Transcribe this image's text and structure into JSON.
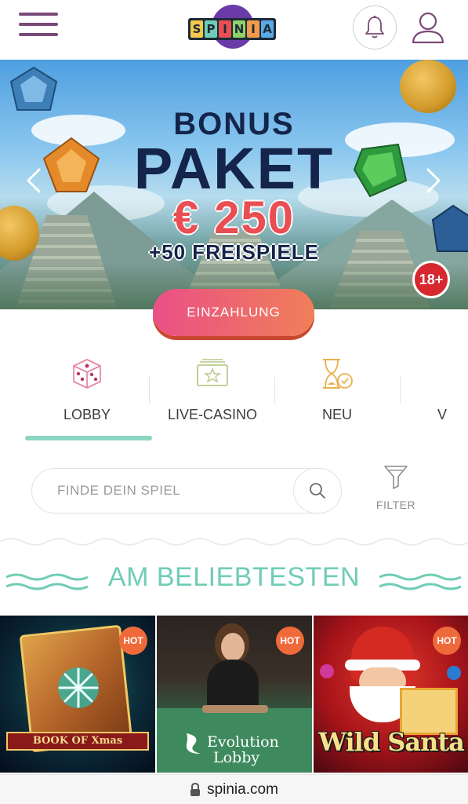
{
  "header": {
    "logo_letters": [
      "S",
      "P",
      "I",
      "N",
      "I",
      "A"
    ],
    "logo_colors": [
      "#f2c94c",
      "#6fcdb5",
      "#e94e52",
      "#8fd16b",
      "#f2994a",
      "#5aa9e6"
    ]
  },
  "hero": {
    "line1": "BONUS",
    "line2": "PAKET",
    "amount": "€ 250",
    "free_spins": "+50 FREISPIELE",
    "age_badge": "18+"
  },
  "deposit_button": "EINZAHLUNG",
  "categories": [
    {
      "label": "LOBBY",
      "icon": "dice-icon",
      "active": true
    },
    {
      "label": "LIVE-CASINO",
      "icon": "live-casino-icon",
      "active": false
    },
    {
      "label": "NEU",
      "icon": "hourglass-icon",
      "active": false
    },
    {
      "label": "V",
      "icon": "",
      "active": false
    }
  ],
  "search": {
    "placeholder": "FINDE DEIN SPIEL",
    "value": ""
  },
  "filter_label": "FILTER",
  "section_title": "AM BELIEBTESTEN",
  "games": [
    {
      "badge": "HOT",
      "title": "BOOK OF Xmas"
    },
    {
      "badge": "HOT",
      "title_line1": "Evolution",
      "title_line2": "Lobby"
    },
    {
      "badge": "HOT",
      "title": "Wild Santa"
    }
  ],
  "url_bar": {
    "url": "spinia.com"
  },
  "colors": {
    "accent_teal": "#6fcdb5",
    "menu_purple": "#7a4a78",
    "deposit_gradient_start": "#ea4f86",
    "deposit_gradient_end": "#f07f58",
    "hot_badge": "#ef6a3a",
    "headline_navy": "#14244a",
    "amount_red": "#e94e52"
  }
}
